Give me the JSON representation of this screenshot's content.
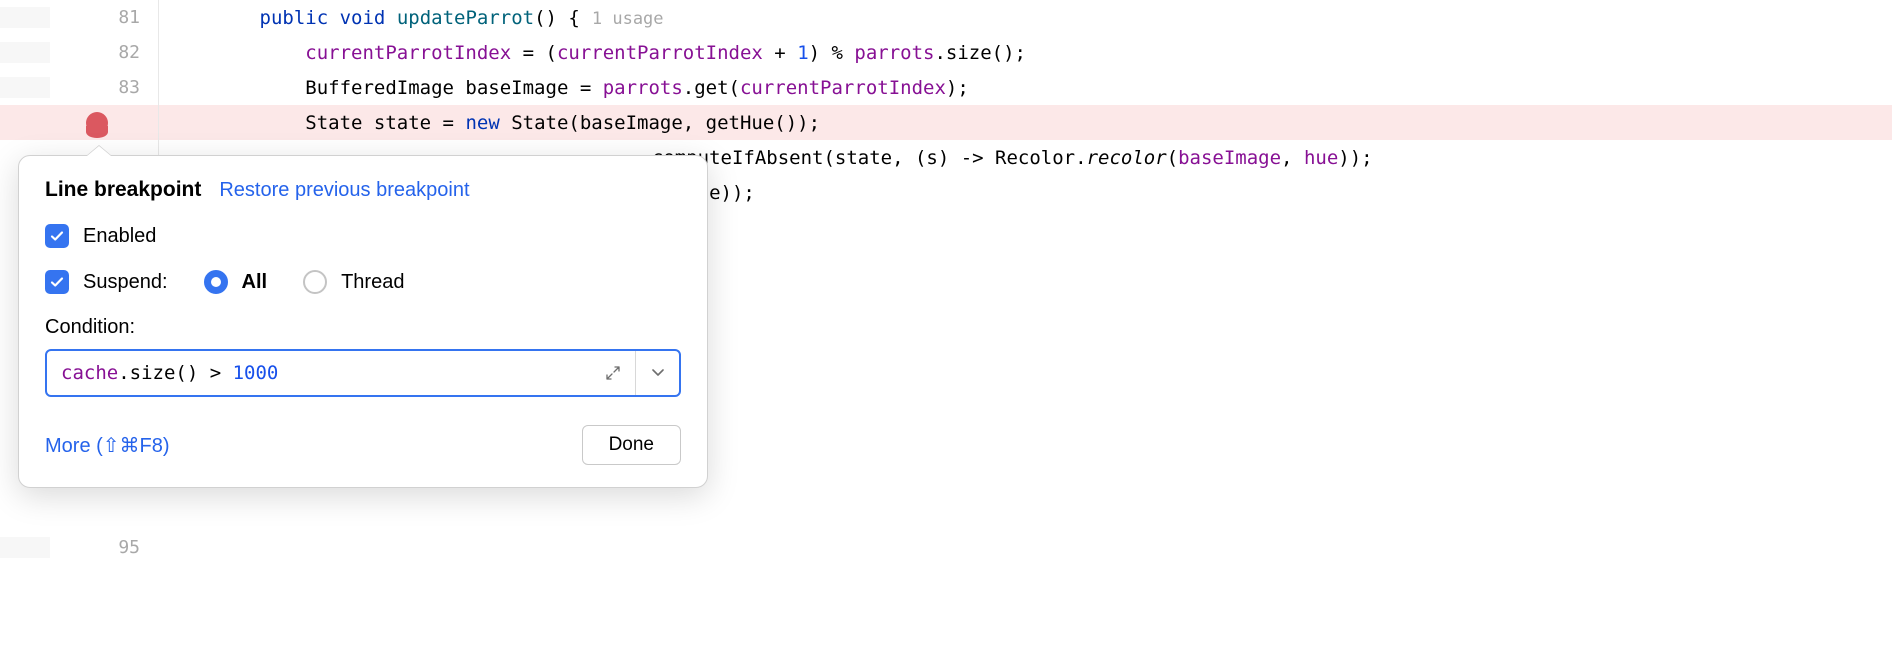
{
  "editor": {
    "lines": [
      {
        "num": "81",
        "indent": "        ",
        "tokens": [
          {
            "t": "public",
            "c": "kw"
          },
          {
            "t": " "
          },
          {
            "t": "void",
            "c": "kw"
          },
          {
            "t": " "
          },
          {
            "t": "updateParrot",
            "c": "method-decl"
          },
          {
            "t": "() {"
          }
        ],
        "usage": "1 usage"
      },
      {
        "num": "82",
        "indent": "            ",
        "tokens": [
          {
            "t": "currentParrotIndex",
            "c": "field"
          },
          {
            "t": " = ("
          },
          {
            "t": "currentParrotIndex",
            "c": "field"
          },
          {
            "t": " + "
          },
          {
            "t": "1",
            "c": "num"
          },
          {
            "t": ") % "
          },
          {
            "t": "parrots",
            "c": "field"
          },
          {
            "t": ".size();"
          }
        ]
      },
      {
        "num": "83",
        "indent": "            ",
        "tokens": [
          {
            "t": "BufferedImage baseImage = "
          },
          {
            "t": "parrots",
            "c": "field"
          },
          {
            "t": ".get("
          },
          {
            "t": "currentParrotIndex",
            "c": "field"
          },
          {
            "t": ");"
          }
        ]
      },
      {
        "num": "",
        "indent": "            ",
        "breakpoint": true,
        "highlighted": true,
        "tokens": [
          {
            "t": "State state = "
          },
          {
            "t": "new",
            "c": "kw"
          },
          {
            "t": " State(baseImage, getHue());"
          }
        ]
      },
      {
        "num": "",
        "indent": "            ",
        "continuation": true,
        "leading": "                                          ",
        "tokens": [
          {
            "t": ".computeIfAbsent(state, (s) -> Recolor."
          },
          {
            "t": "recolor",
            "c": "italic"
          },
          {
            "t": "("
          },
          {
            "t": "baseImage",
            "c": "field"
          },
          {
            "t": ", "
          },
          {
            "t": "hue",
            "c": "field"
          },
          {
            "t": "));"
          }
        ]
      },
      {
        "num": "",
        "indent": "            ",
        "continuation": true,
        "leading": "                                          ",
        "tokens": [
          {
            "t": "edImage));"
          }
        ]
      }
    ],
    "trailing_line_number": "95"
  },
  "popup": {
    "title": "Line breakpoint",
    "restore_link": "Restore previous breakpoint",
    "enabled_label": "Enabled",
    "suspend_label": "Suspend:",
    "radio_all": "All",
    "radio_thread": "Thread",
    "condition_label": "Condition:",
    "condition_tokens": [
      {
        "t": "cache",
        "c": "field"
      },
      {
        "t": ".size() > "
      },
      {
        "t": "1000",
        "c": "num"
      }
    ],
    "more_link": "More (⇧⌘F8)",
    "done_label": "Done"
  }
}
